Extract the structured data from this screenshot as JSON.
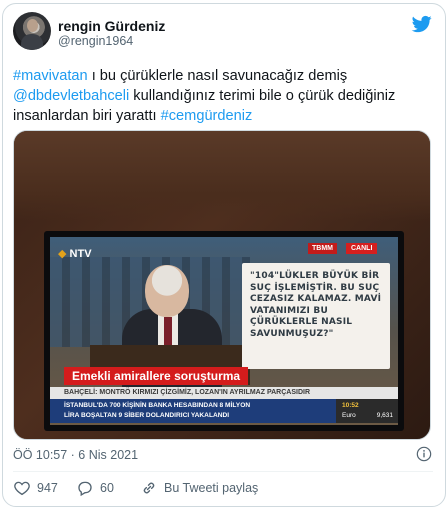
{
  "author": {
    "name": "rengin Gürdeniz",
    "handle": "@rengin1964"
  },
  "tweet": {
    "segments": [
      {
        "text": "#mavivatan",
        "link": true
      },
      {
        "text": "  ı bu çürüklerle nasıl savunacağız demiş ",
        "link": false
      },
      {
        "text": "@dbdevletbahceli",
        "link": true
      },
      {
        "text": " kullandığınız terimi bile o çürük dediğiniz insanlardan biri yarattı ",
        "link": false
      },
      {
        "text": "#cemgürdeniz",
        "link": true
      }
    ]
  },
  "media": {
    "channel_logo": "NTV",
    "tag_tbmm": "TBMM",
    "tag_live": "CANLI",
    "quote": "\"104\"LÜKLER BÜYÜK BİR SUÇ İŞLEMİŞTİR. BU SUÇ CEZASIZ KALAMAZ. MAVİ VATANIMIZI BU ÇÜRÜKLERLE NASIL SAVUNMUŞUZ?\"",
    "headline": "Emekli amirallere soruşturma",
    "ticker_top": "BAHÇELİ: MONTRÖ KIRMIZI ÇİZGİMİZ, LOZAN'IN AYRILMAZ PARÇASIDIR",
    "ticker_bottom_1": "İSTANBUL'DA 700 KİŞİNİN BANKA HESABINDAN 8 MİLYON",
    "ticker_bottom_2": "LİRA BOŞALTAN 9 SİBER DOLANDIRICI YAKALANDI",
    "clock": "10:52",
    "market_label": "Euro",
    "market_value": "9,631"
  },
  "meta": {
    "timestamp": "ÖÖ 10:57 · 6 Nis 2021"
  },
  "actions": {
    "likes": "947",
    "replies": "60",
    "share_label": "Bu Tweeti paylaş"
  },
  "colors": {
    "link": "#1d9bf0",
    "text": "#0f1419",
    "muted": "#536471",
    "border": "#cfd9de"
  }
}
